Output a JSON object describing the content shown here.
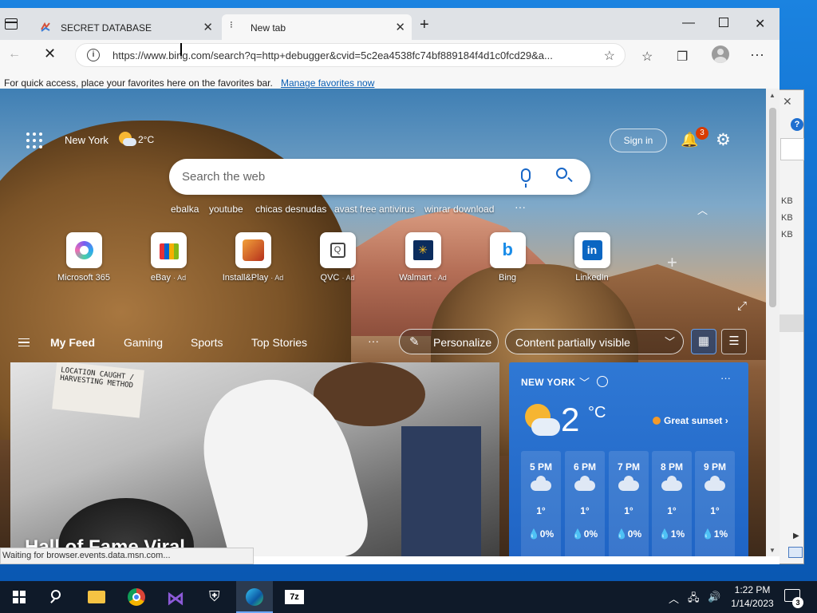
{
  "browser": {
    "tabs": [
      {
        "title": "SECRET DATABASE"
      },
      {
        "title": "New tab"
      }
    ],
    "url": "https://www.bing.com/search?q=http+debugger&cvid=5c2ea4538fc74bf889184f4d1c0fcd29&a...",
    "favorites_message": "For quick access, place your favorites here on the favorites bar.",
    "favorites_link": "Manage favorites now",
    "status_text": "Waiting for browser.events.data.msn.com..."
  },
  "newtab": {
    "location": "New York",
    "temp_small": "2°C",
    "signin": "Sign in",
    "notifications": "3",
    "search_placeholder": "Search the web",
    "trending": [
      "ebalka",
      "youtube",
      "chicas desnudas",
      "avast free antivirus",
      "winrar download"
    ],
    "quick_links": [
      {
        "label": "Microsoft 365",
        "ad": ""
      },
      {
        "label": "eBay",
        "ad": "· Ad"
      },
      {
        "label": "Install&Play",
        "ad": "· Ad"
      },
      {
        "label": "QVC",
        "ad": "· Ad"
      },
      {
        "label": "Walmart",
        "ad": "· Ad"
      },
      {
        "label": "Bing",
        "ad": ""
      },
      {
        "label": "LinkedIn",
        "ad": ""
      }
    ],
    "feed_nav": [
      "My Feed",
      "Gaming",
      "Sports",
      "Top Stories"
    ],
    "personalize": "Personalize",
    "content_visibility": "Content partially visible",
    "hero_title": "Hall of Fame Viral",
    "hero_sign": "LOCATION CAUGHT / HARVESTING METHOD",
    "weather": {
      "city": "NEW YORK",
      "temp": "2",
      "unit": "°C",
      "sunset": "Great sunset",
      "hours": [
        {
          "time": "5 PM",
          "temp": "1°",
          "precip": "0%"
        },
        {
          "time": "6 PM",
          "temp": "1°",
          "precip": "0%"
        },
        {
          "time": "7 PM",
          "temp": "1°",
          "precip": "0%"
        },
        {
          "time": "8 PM",
          "temp": "1°",
          "precip": "1%"
        },
        {
          "time": "9 PM",
          "temp": "1°",
          "precip": "1%"
        }
      ]
    }
  },
  "bg_window": {
    "kb_labels": [
      "KB",
      "KB",
      "KB"
    ],
    "help": "?"
  },
  "taskbar": {
    "time": "1:22 PM",
    "date": "1/14/2023",
    "notif_count": "3"
  },
  "colors": {
    "accent": "#1766c7",
    "weather_bg": "#2f78d4",
    "taskbar": "#0f1a29"
  }
}
